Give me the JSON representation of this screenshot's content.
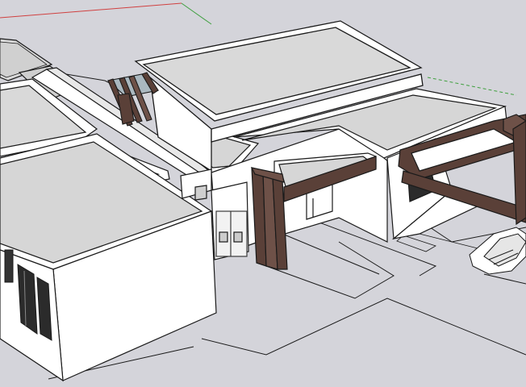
{
  "app": {
    "scene": "3d-viewport",
    "style": "shaded-with-edges"
  },
  "colors": {
    "ground": "#d4d4da",
    "wall": "#ffffff",
    "roof": "#d9d9d9",
    "roof_dark": "#cfcfcf",
    "edge": "#1a1a1a",
    "wood": "#5a4038",
    "wood_light": "#6e5148",
    "glass": "#aab8c0",
    "axis_red": "#d04040",
    "axis_green": "#40a040",
    "door_frame": "#3a3a3a"
  },
  "axes": {
    "red": "x-axis",
    "green": "y-axis",
    "blue": "z-axis"
  }
}
